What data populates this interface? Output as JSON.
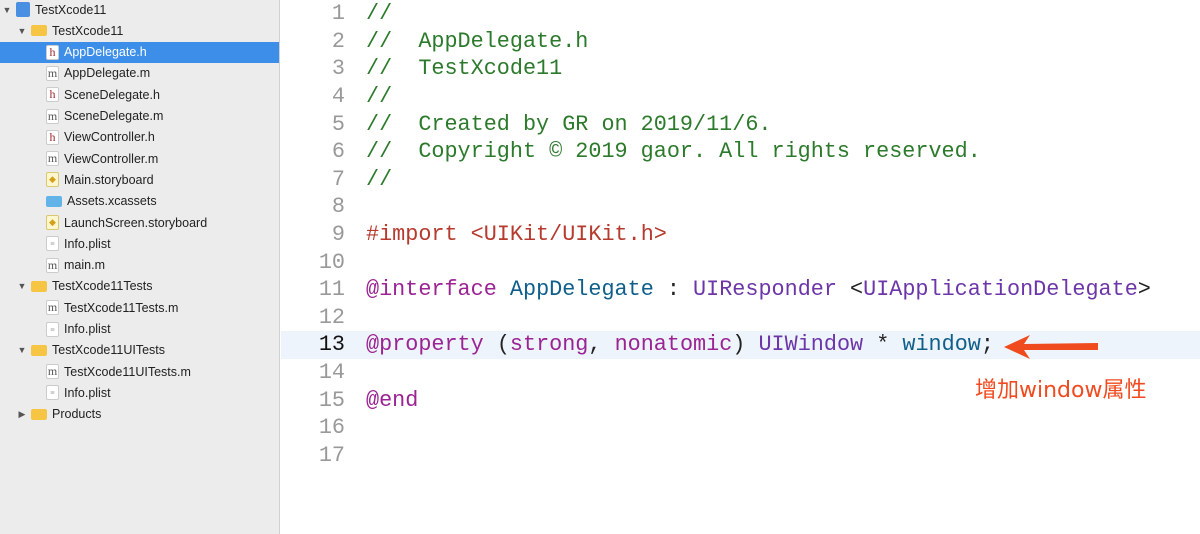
{
  "navigator": {
    "items": [
      {
        "label": "TestXcode11",
        "icon": "project-icon",
        "depth": 0,
        "tri": "▼"
      },
      {
        "label": "TestXcode11",
        "icon": "folder-icon",
        "depth": 1,
        "tri": "▼"
      },
      {
        "label": "AppDelegate.h",
        "icon": "header-file-icon",
        "depth": 2,
        "selected": true
      },
      {
        "label": "AppDelegate.m",
        "icon": "implementation-file-icon",
        "depth": 2
      },
      {
        "label": "SceneDelegate.h",
        "icon": "header-file-icon",
        "depth": 2
      },
      {
        "label": "SceneDelegate.m",
        "icon": "implementation-file-icon",
        "depth": 2
      },
      {
        "label": "ViewController.h",
        "icon": "header-file-icon",
        "depth": 2
      },
      {
        "label": "ViewController.m",
        "icon": "implementation-file-icon",
        "depth": 2
      },
      {
        "label": "Main.storyboard",
        "icon": "storyboard-icon",
        "depth": 2
      },
      {
        "label": "Assets.xcassets",
        "icon": "assets-folder-icon",
        "depth": 2
      },
      {
        "label": "LaunchScreen.storyboard",
        "icon": "storyboard-icon",
        "depth": 2
      },
      {
        "label": "Info.plist",
        "icon": "plist-icon",
        "depth": 2
      },
      {
        "label": "main.m",
        "icon": "implementation-file-icon",
        "depth": 2
      },
      {
        "label": "TestXcode11Tests",
        "icon": "folder-icon",
        "depth": 1,
        "tri": "▼"
      },
      {
        "label": "TestXcode11Tests.m",
        "icon": "implementation-file-icon",
        "depth": 2
      },
      {
        "label": "Info.plist",
        "icon": "plist-icon",
        "depth": 2
      },
      {
        "label": "TestXcode11UITests",
        "icon": "folder-icon",
        "depth": 1,
        "tri": "▼"
      },
      {
        "label": "TestXcode11UITests.m",
        "icon": "implementation-file-icon",
        "depth": 2
      },
      {
        "label": "Info.plist",
        "icon": "plist-icon",
        "depth": 2
      },
      {
        "label": "Products",
        "icon": "folder-icon",
        "depth": 1,
        "tri": "▶"
      }
    ]
  },
  "colors": {
    "comment": "#2c7a2c",
    "keyword": "#9b2393",
    "string": "#b63a2e",
    "class": "#6c36a9",
    "ident": "#0f5f8a",
    "plain": "#222222",
    "annotation": "#f04a1f"
  },
  "editor": {
    "current_line": 13,
    "lines": [
      {
        "n": "1",
        "tokens": [
          {
            "t": "//",
            "c": "comment"
          }
        ]
      },
      {
        "n": "2",
        "tokens": [
          {
            "t": "//  AppDelegate.h",
            "c": "comment"
          }
        ]
      },
      {
        "n": "3",
        "tokens": [
          {
            "t": "//  TestXcode11",
            "c": "comment"
          }
        ]
      },
      {
        "n": "4",
        "tokens": [
          {
            "t": "//",
            "c": "comment"
          }
        ]
      },
      {
        "n": "5",
        "tokens": [
          {
            "t": "//  Created by GR on 2019/11/6.",
            "c": "comment"
          }
        ]
      },
      {
        "n": "6",
        "tokens": [
          {
            "t": "//  Copyright © 2019 gaor. All rights reserved.",
            "c": "comment"
          }
        ]
      },
      {
        "n": "7",
        "tokens": [
          {
            "t": "//",
            "c": "comment"
          }
        ]
      },
      {
        "n": "8",
        "tokens": []
      },
      {
        "n": "9",
        "tokens": [
          {
            "t": "#import ",
            "c": "string"
          },
          {
            "t": "<UIKit/UIKit.h>",
            "c": "string"
          }
        ]
      },
      {
        "n": "10",
        "tokens": []
      },
      {
        "n": "11",
        "tokens": [
          {
            "t": "@interface",
            "c": "keyword"
          },
          {
            "t": " ",
            "c": "plain"
          },
          {
            "t": "AppDelegate",
            "c": "ident"
          },
          {
            "t": " : ",
            "c": "plain"
          },
          {
            "t": "UIResponder",
            "c": "class"
          },
          {
            "t": " <",
            "c": "plain"
          },
          {
            "t": "UIApplicationDelegate",
            "c": "class"
          },
          {
            "t": ">",
            "c": "plain"
          }
        ]
      },
      {
        "n": "12",
        "tokens": []
      },
      {
        "n": "13",
        "tokens": [
          {
            "t": "@property",
            "c": "keyword"
          },
          {
            "t": " (",
            "c": "plain"
          },
          {
            "t": "strong",
            "c": "keyword"
          },
          {
            "t": ", ",
            "c": "plain"
          },
          {
            "t": "nonatomic",
            "c": "keyword"
          },
          {
            "t": ") ",
            "c": "plain"
          },
          {
            "t": "UIWindow",
            "c": "class"
          },
          {
            "t": " * ",
            "c": "plain"
          },
          {
            "t": "window",
            "c": "ident"
          },
          {
            "t": ";",
            "c": "plain"
          }
        ]
      },
      {
        "n": "14",
        "tokens": []
      },
      {
        "n": "15",
        "tokens": [
          {
            "t": "@end",
            "c": "keyword"
          }
        ]
      },
      {
        "n": "16",
        "tokens": []
      },
      {
        "n": "17",
        "tokens": []
      }
    ]
  },
  "annotation": {
    "text": "增加window属性"
  }
}
